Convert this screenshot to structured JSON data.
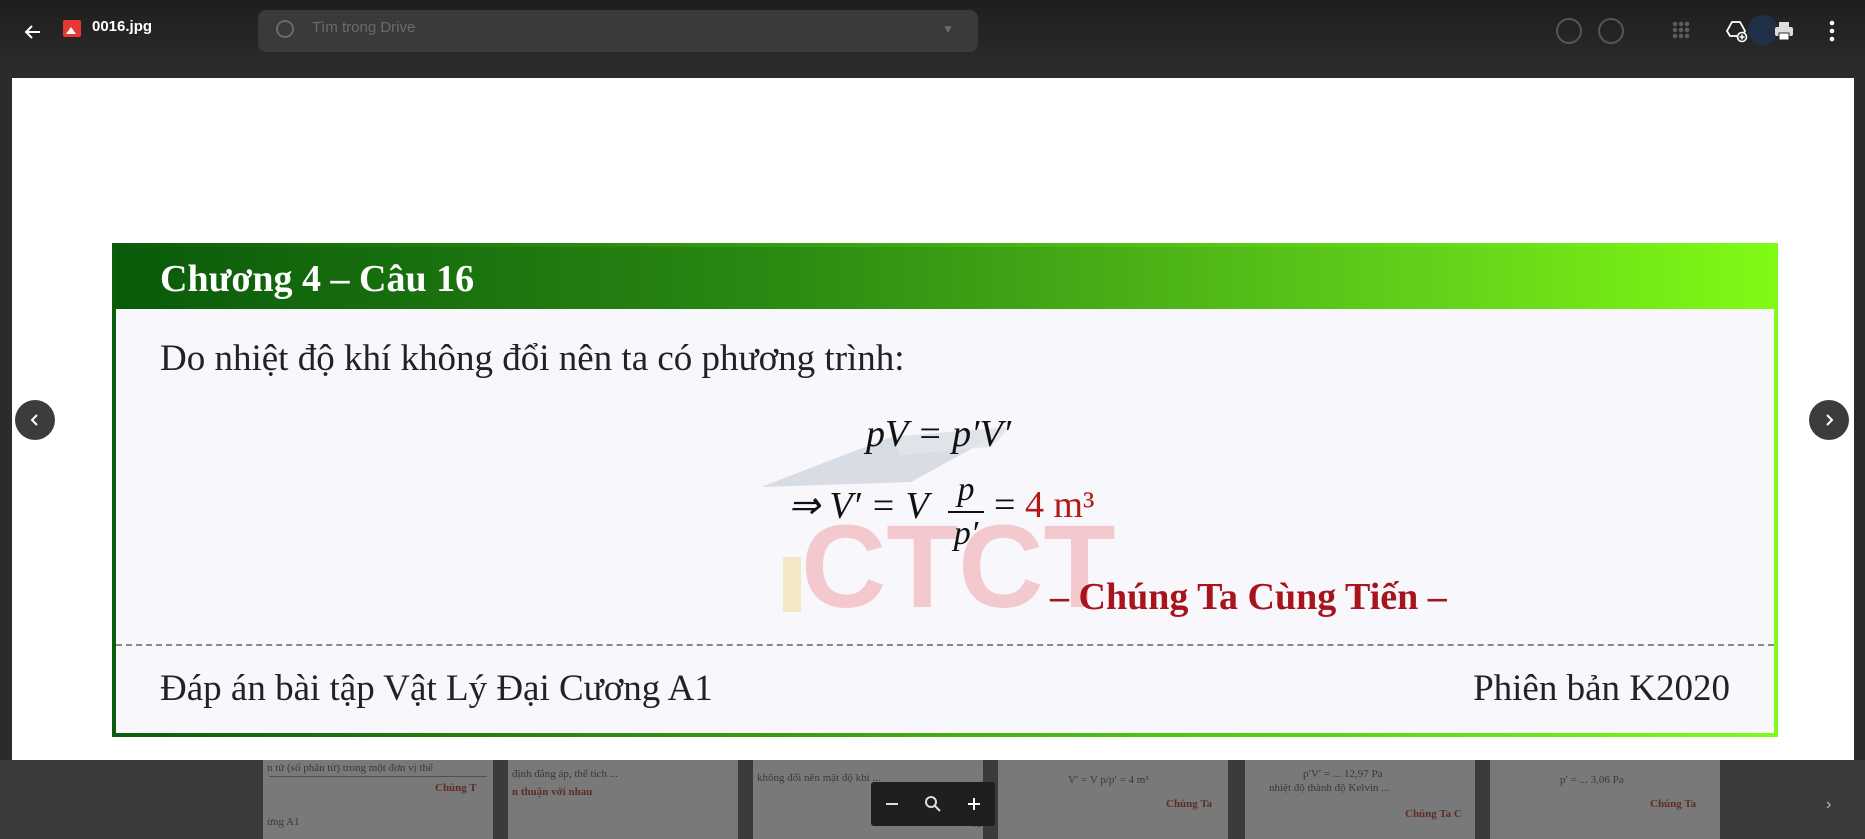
{
  "header": {
    "file_name": "0016.jpg",
    "search_placeholder": "Tìm trong Drive"
  },
  "slide": {
    "title": "Chương 4 – Câu 16",
    "body": "Do nhiệt độ khí không đổi nên ta có phương trình:",
    "eq1": "pV = p′V′",
    "eq2_left": "⇒ V′ = V",
    "eq2_frac_num": "p",
    "eq2_frac_den": "p′",
    "eq2_equals": "=",
    "eq2_value": "4 m³",
    "slogan": "– Chúng Ta Cùng Tiến –",
    "footer_left": "Đáp án bài tập Vật Lý Đại Cương A1",
    "footer_right": "Phiên bản K2020"
  },
  "thumbnails": {
    "t1": "Chúng T",
    "t2": "ừng A1",
    "t3": "Chúng Ta",
    "t4": "Chúng Ta C",
    "t5": "Chúng Ta"
  },
  "colors": {
    "accent_green_dark": "#0a5a0a",
    "accent_green_light": "#80fb14",
    "slogan_red": "#a8141e",
    "value_red": "#b01a1a"
  },
  "icons": [
    "arrow-back-icon",
    "image-file-icon",
    "search-icon",
    "help-icon",
    "settings-icon",
    "apps-grid-icon",
    "add-to-drive-icon",
    "print-icon",
    "more-vert-icon",
    "chevron-left-icon",
    "chevron-right-icon",
    "zoom-out-icon",
    "zoom-reset-icon",
    "zoom-in-icon"
  ]
}
